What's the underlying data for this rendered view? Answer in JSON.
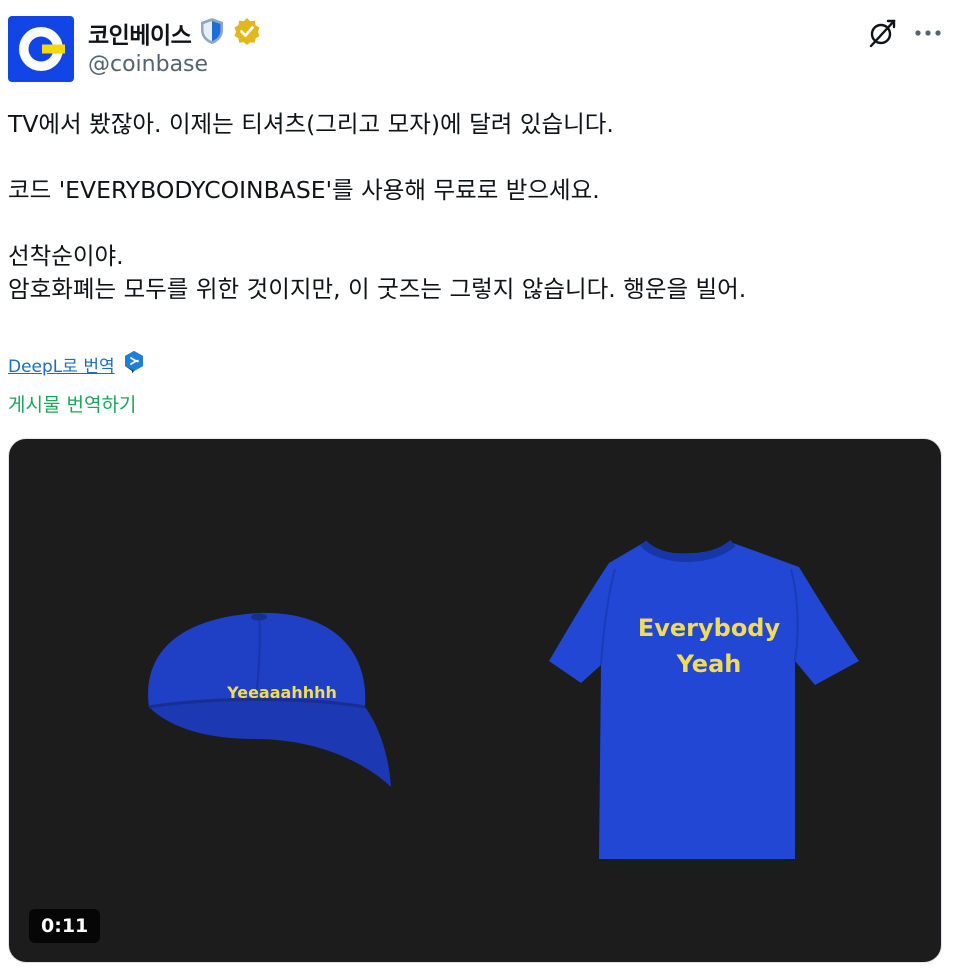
{
  "author": {
    "display_name": "코인베이스",
    "handle": "@coinbase",
    "avatar_icon": "coinbase-logo-icon",
    "badges": [
      "government-shield-icon",
      "gold-verified-icon"
    ]
  },
  "header_actions": {
    "grok_icon": "grok-icon",
    "more_icon": "more-dots-icon"
  },
  "tweet": {
    "lines": [
      "TV에서 봤잖아. 이제는 티셔츠(그리고 모자)에 달려 있습니다.",
      "",
      "코드 'EVERYBODYCOINBASE'를 사용해 무료로 받으세요.",
      "",
      "선착순이야.",
      "암호화폐는 모두를 위한 것이지만, 이 굿즈는 그렇지 않습니다. 행운을 빌어."
    ]
  },
  "translation": {
    "deepl_label": "DeepL로 번역",
    "translate_post": "게시물 번역하기"
  },
  "media": {
    "cap_text": "Yeeaaahhhh",
    "shirt_line1": "Everybody",
    "shirt_line2": "Yeah",
    "timestamp": "0:11",
    "colors": {
      "background": "#1c1c1c",
      "merch_blue": "#1f3fc4",
      "print_yellow": "#f3dc55"
    }
  },
  "colors": {
    "brand_blue": "#1145e6",
    "handle_gray": "#536471",
    "deepl_link": "#1d6fb8",
    "translate_green": "#1da55b"
  }
}
